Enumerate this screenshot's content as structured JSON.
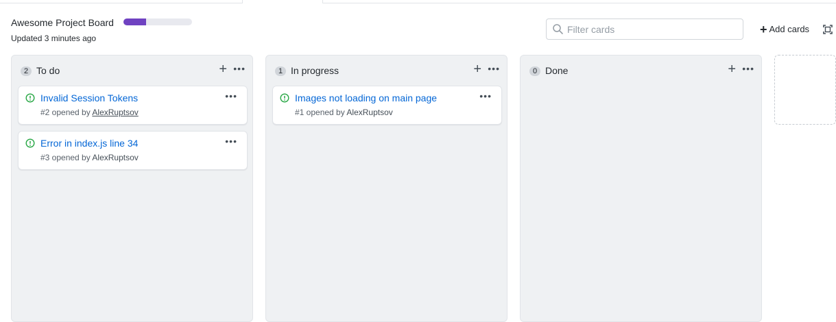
{
  "project": {
    "title": "Awesome Project Board",
    "updated": "Updated 3 minutes ago",
    "progress_fraction": 0.33,
    "progress_color": "#6f42c1"
  },
  "filter": {
    "placeholder": "Filter cards"
  },
  "toolbar": {
    "add_cards_label": "Add cards"
  },
  "icons": {
    "search": "search-icon",
    "plus": "plus-icon",
    "more": "kebab-horizontal-icon",
    "issue": "issue-opened-icon",
    "fullscreen": "screen-full-icon"
  },
  "columns": [
    {
      "count": "2",
      "title": "To do",
      "cards": [
        {
          "title": "Invalid Session Tokens",
          "meta": "#2 opened by",
          "author": "AlexRuptsov"
        },
        {
          "title": "Error in index.js line 34",
          "meta": "#3 opened by",
          "author": "AlexRuptsov"
        }
      ]
    },
    {
      "count": "1",
      "title": "In progress",
      "cards": [
        {
          "title": "Images not loading on main page",
          "meta": "#1 opened by",
          "author": "AlexRuptsov"
        }
      ]
    },
    {
      "count": "0",
      "title": "Done",
      "cards": []
    }
  ],
  "colors": {
    "accent_link": "#0366d6",
    "issue_open": "#28a745"
  }
}
